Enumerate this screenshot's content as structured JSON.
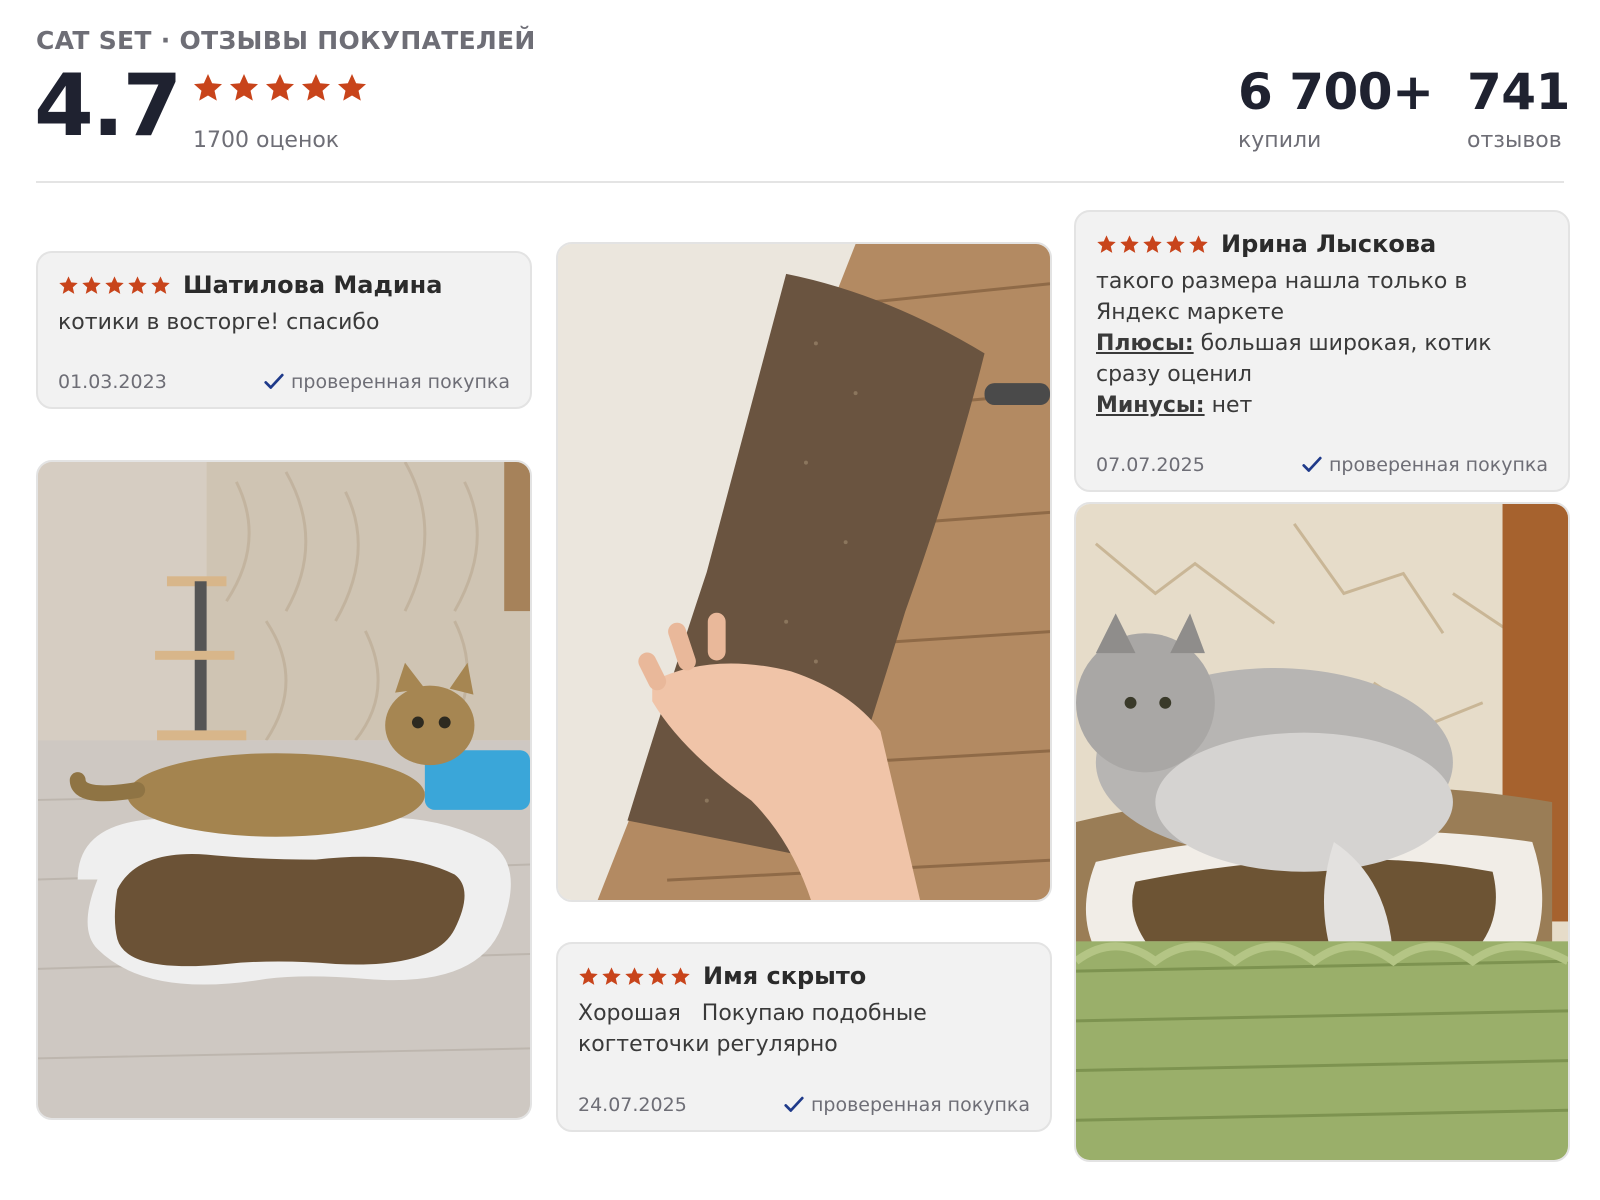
{
  "header": {
    "brand": "CAT SET · ОТЗЫВЫ ПОКУПАТЕЛЕЙ",
    "rating": "4.7",
    "rating_stars": 5,
    "ratings_count": "1700 оценок",
    "buyers_value": "6 700+",
    "buyers_label": "купили",
    "reviews_value": "741",
    "reviews_label": "отзывов"
  },
  "reviews": [
    {
      "stars": 5,
      "author": "Шатилова Мадина",
      "text": "котики в восторге! спасибо",
      "date": "01.03.2023",
      "verified": "проверенная покупка"
    },
    {
      "stars": 5,
      "author": "Ирина Лыскова",
      "text": "такого размера нашла только в Яндекс маркете",
      "pros_label": "Плюсы:",
      "pros": "большая широкая, котик сразу оценил",
      "cons_label": "Минусы:",
      "cons": "нет",
      "date": "07.07.2025",
      "verified": "проверенная покупка"
    },
    {
      "stars": 5,
      "author": "Имя скрыто",
      "text": "Хорошая   Покупаю подобные когтеточки регулярно",
      "date": "24.07.2025",
      "verified": "проверенная покупка"
    }
  ],
  "colors": {
    "star": "#c8441b",
    "check": "#1f3a8a",
    "title": "#1f2230",
    "muted": "#6e6e76"
  },
  "icons": {
    "star": "star-icon",
    "check": "checkmark-icon"
  }
}
